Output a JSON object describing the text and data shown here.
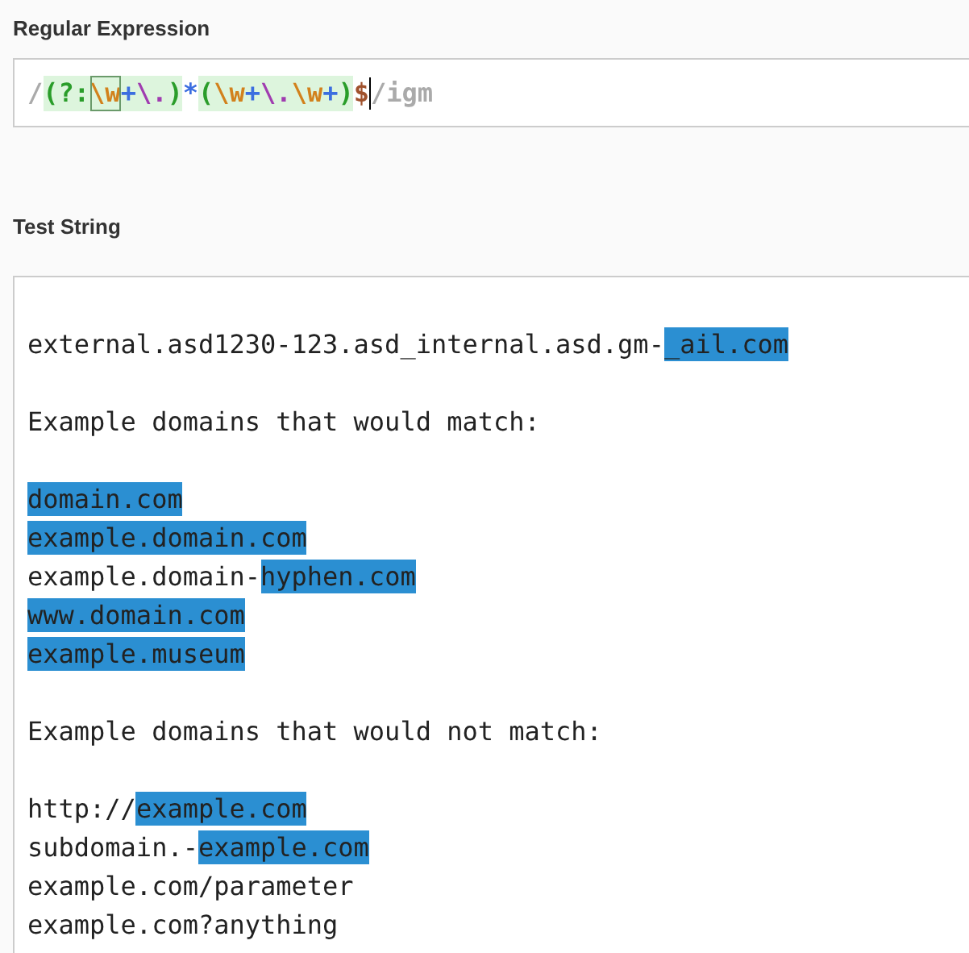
{
  "regex_section": {
    "label": "Regular Expression"
  },
  "regex": {
    "tokens": [
      {
        "text": "/",
        "kind": "delimiter",
        "grouped": false,
        "selected": false
      },
      {
        "text": "(?:",
        "kind": "group",
        "grouped": true,
        "selected": false
      },
      {
        "text": "\\w",
        "kind": "word",
        "grouped": true,
        "selected": true
      },
      {
        "text": "+",
        "kind": "quantifier",
        "grouped": true,
        "selected": false
      },
      {
        "text": "\\.",
        "kind": "escape",
        "grouped": true,
        "selected": false
      },
      {
        "text": ")",
        "kind": "group",
        "grouped": true,
        "selected": false
      },
      {
        "text": "*",
        "kind": "quantifier",
        "grouped": false,
        "selected": false
      },
      {
        "text": "(",
        "kind": "group",
        "grouped": true,
        "selected": false
      },
      {
        "text": "\\w",
        "kind": "word",
        "grouped": true,
        "selected": false
      },
      {
        "text": "+",
        "kind": "quantifier",
        "grouped": true,
        "selected": false
      },
      {
        "text": "\\.",
        "kind": "escape",
        "grouped": true,
        "selected": false
      },
      {
        "text": "\\w",
        "kind": "word",
        "grouped": true,
        "selected": false
      },
      {
        "text": "+",
        "kind": "quantifier",
        "grouped": true,
        "selected": false
      },
      {
        "text": ")",
        "kind": "group",
        "grouped": true,
        "selected": false
      },
      {
        "text": "$",
        "kind": "anchor",
        "grouped": false,
        "selected": false
      },
      {
        "text": "/igm",
        "kind": "flags",
        "grouped": false,
        "selected": false
      }
    ]
  },
  "test_section": {
    "label": "Test String"
  },
  "test_lines": [
    {
      "lines": [
        {
          "segments": [
            {
              "text": "external.asd1230-123.asd_internal.asd.gm-",
              "matched": false
            },
            {
              "text": "_ail.com",
              "matched": true
            }
          ]
        }
      ]
    },
    {
      "lines": [
        {
          "segments": [
            {
              "text": "Example domains that would match:",
              "matched": false
            }
          ]
        }
      ]
    },
    {
      "lines": [
        {
          "segments": [
            {
              "text": "domain.com",
              "matched": true
            }
          ]
        },
        {
          "segments": [
            {
              "text": "example.domain.com",
              "matched": true
            }
          ]
        },
        {
          "segments": [
            {
              "text": "example.domain-",
              "matched": false
            },
            {
              "text": "hyphen.com",
              "matched": true
            }
          ]
        },
        {
          "segments": [
            {
              "text": "www.domain.com",
              "matched": true
            }
          ]
        },
        {
          "segments": [
            {
              "text": "example.museum",
              "matched": true
            }
          ]
        }
      ]
    },
    {
      "lines": [
        {
          "segments": [
            {
              "text": "Example domains that would not match:",
              "matched": false
            }
          ]
        }
      ]
    },
    {
      "lines": [
        {
          "segments": [
            {
              "text": "http://",
              "matched": false
            },
            {
              "text": "example.com",
              "matched": true
            }
          ]
        },
        {
          "segments": [
            {
              "text": "subdomain.-",
              "matched": false
            },
            {
              "text": "example.com",
              "matched": true
            }
          ]
        },
        {
          "segments": [
            {
              "text": "example.com/parameter",
              "matched": false
            }
          ]
        },
        {
          "segments": [
            {
              "text": "example.com?anything",
              "matched": false
            }
          ]
        }
      ]
    }
  ]
}
